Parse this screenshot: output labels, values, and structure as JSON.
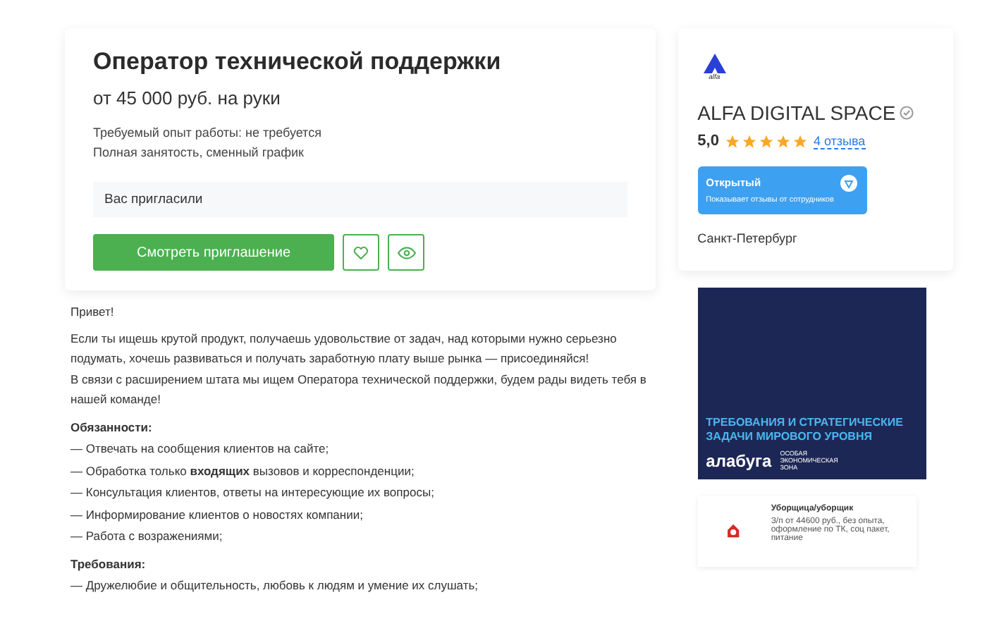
{
  "vacancy": {
    "title": "Оператор технической поддержки",
    "salary": "от 45 000 руб. на руки",
    "details": [
      "Требуемый опыт работы: не требуется",
      "Полная занятость, сменный график"
    ],
    "status": "Вас пригласили",
    "primary_button": "Смотреть приглашение",
    "favorite": false
  },
  "company": {
    "logo_text": "alfa",
    "name": "ALFA DIGITAL SPACE",
    "verified": true,
    "rating": "5,0",
    "stars": 5,
    "reviews_link": "4 отзыва",
    "badge": {
      "title": "Открытый",
      "subtitle": "Показывает отзывы от сотрудников"
    },
    "city": "Санкт-Петербург"
  },
  "description": {
    "greeting": "Привет!",
    "intro": [
      "Если ты ищешь крутой продукт, получаешь удовольствие от задач, над которыми нужно серьезно подумать, хочешь развиваться и получать заработную плату выше рынка — присоединяйся!",
      "В связи с расширением штата мы ищем Оператора технической поддержки, будем рады видеть тебя в нашей команде!"
    ],
    "sections": [
      {
        "heading": "Обязанности:",
        "items": [
          "— Отвечать на сообщения клиентов на сайте;",
          "— Обработка только **входящих** вызовов и корреспонденции;",
          "— Консультация клиентов, ответы на интересующие их вопросы;",
          "— Информирование клиентов о новостях компании;",
          "— Работа с возражениями;"
        ]
      },
      {
        "heading": "Требования:",
        "items": [
          "— Дружелюбие и общительность, любовь к людям и умение их слушать;"
        ]
      }
    ]
  },
  "banner": {
    "headline": "ТРЕБОВАНИЯ И СТРАТЕГИЧЕСКИЕ ЗАДАЧИ МИРОВОГО УРОВНЯ",
    "brand": "алабуга",
    "brand_note": "ОСОБАЯ ЭКОНОМИЧЕСКАЯ ЗОНА"
  },
  "job_ad": {
    "title": "Уборщица/уборщик",
    "text": "З/п от 44600 руб., без опыта, оформление по ТК, соц пакет, питание"
  }
}
